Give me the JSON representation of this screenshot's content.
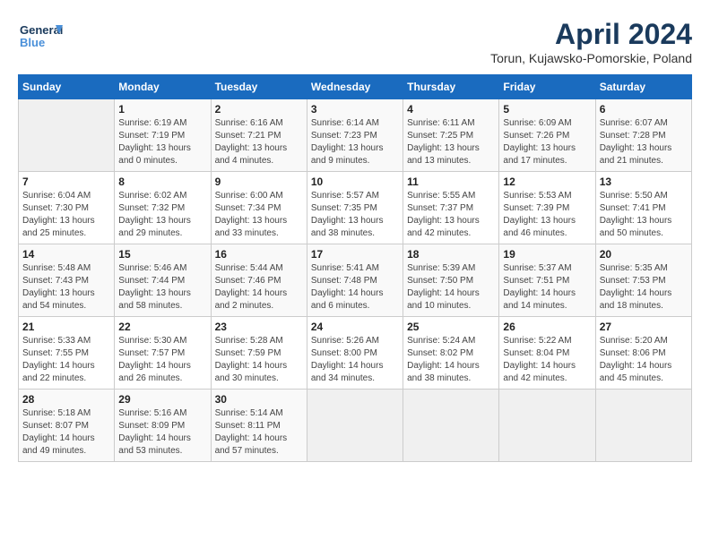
{
  "header": {
    "logo_line1": "General",
    "logo_line2": "Blue",
    "title": "April 2024",
    "location": "Torun, Kujawsko-Pomorskie, Poland"
  },
  "days_of_week": [
    "Sunday",
    "Monday",
    "Tuesday",
    "Wednesday",
    "Thursday",
    "Friday",
    "Saturday"
  ],
  "weeks": [
    [
      {
        "day": "",
        "info": ""
      },
      {
        "day": "1",
        "info": "Sunrise: 6:19 AM\nSunset: 7:19 PM\nDaylight: 13 hours\nand 0 minutes."
      },
      {
        "day": "2",
        "info": "Sunrise: 6:16 AM\nSunset: 7:21 PM\nDaylight: 13 hours\nand 4 minutes."
      },
      {
        "day": "3",
        "info": "Sunrise: 6:14 AM\nSunset: 7:23 PM\nDaylight: 13 hours\nand 9 minutes."
      },
      {
        "day": "4",
        "info": "Sunrise: 6:11 AM\nSunset: 7:25 PM\nDaylight: 13 hours\nand 13 minutes."
      },
      {
        "day": "5",
        "info": "Sunrise: 6:09 AM\nSunset: 7:26 PM\nDaylight: 13 hours\nand 17 minutes."
      },
      {
        "day": "6",
        "info": "Sunrise: 6:07 AM\nSunset: 7:28 PM\nDaylight: 13 hours\nand 21 minutes."
      }
    ],
    [
      {
        "day": "7",
        "info": "Sunrise: 6:04 AM\nSunset: 7:30 PM\nDaylight: 13 hours\nand 25 minutes."
      },
      {
        "day": "8",
        "info": "Sunrise: 6:02 AM\nSunset: 7:32 PM\nDaylight: 13 hours\nand 29 minutes."
      },
      {
        "day": "9",
        "info": "Sunrise: 6:00 AM\nSunset: 7:34 PM\nDaylight: 13 hours\nand 33 minutes."
      },
      {
        "day": "10",
        "info": "Sunrise: 5:57 AM\nSunset: 7:35 PM\nDaylight: 13 hours\nand 38 minutes."
      },
      {
        "day": "11",
        "info": "Sunrise: 5:55 AM\nSunset: 7:37 PM\nDaylight: 13 hours\nand 42 minutes."
      },
      {
        "day": "12",
        "info": "Sunrise: 5:53 AM\nSunset: 7:39 PM\nDaylight: 13 hours\nand 46 minutes."
      },
      {
        "day": "13",
        "info": "Sunrise: 5:50 AM\nSunset: 7:41 PM\nDaylight: 13 hours\nand 50 minutes."
      }
    ],
    [
      {
        "day": "14",
        "info": "Sunrise: 5:48 AM\nSunset: 7:43 PM\nDaylight: 13 hours\nand 54 minutes."
      },
      {
        "day": "15",
        "info": "Sunrise: 5:46 AM\nSunset: 7:44 PM\nDaylight: 13 hours\nand 58 minutes."
      },
      {
        "day": "16",
        "info": "Sunrise: 5:44 AM\nSunset: 7:46 PM\nDaylight: 14 hours\nand 2 minutes."
      },
      {
        "day": "17",
        "info": "Sunrise: 5:41 AM\nSunset: 7:48 PM\nDaylight: 14 hours\nand 6 minutes."
      },
      {
        "day": "18",
        "info": "Sunrise: 5:39 AM\nSunset: 7:50 PM\nDaylight: 14 hours\nand 10 minutes."
      },
      {
        "day": "19",
        "info": "Sunrise: 5:37 AM\nSunset: 7:51 PM\nDaylight: 14 hours\nand 14 minutes."
      },
      {
        "day": "20",
        "info": "Sunrise: 5:35 AM\nSunset: 7:53 PM\nDaylight: 14 hours\nand 18 minutes."
      }
    ],
    [
      {
        "day": "21",
        "info": "Sunrise: 5:33 AM\nSunset: 7:55 PM\nDaylight: 14 hours\nand 22 minutes."
      },
      {
        "day": "22",
        "info": "Sunrise: 5:30 AM\nSunset: 7:57 PM\nDaylight: 14 hours\nand 26 minutes."
      },
      {
        "day": "23",
        "info": "Sunrise: 5:28 AM\nSunset: 7:59 PM\nDaylight: 14 hours\nand 30 minutes."
      },
      {
        "day": "24",
        "info": "Sunrise: 5:26 AM\nSunset: 8:00 PM\nDaylight: 14 hours\nand 34 minutes."
      },
      {
        "day": "25",
        "info": "Sunrise: 5:24 AM\nSunset: 8:02 PM\nDaylight: 14 hours\nand 38 minutes."
      },
      {
        "day": "26",
        "info": "Sunrise: 5:22 AM\nSunset: 8:04 PM\nDaylight: 14 hours\nand 42 minutes."
      },
      {
        "day": "27",
        "info": "Sunrise: 5:20 AM\nSunset: 8:06 PM\nDaylight: 14 hours\nand 45 minutes."
      }
    ],
    [
      {
        "day": "28",
        "info": "Sunrise: 5:18 AM\nSunset: 8:07 PM\nDaylight: 14 hours\nand 49 minutes."
      },
      {
        "day": "29",
        "info": "Sunrise: 5:16 AM\nSunset: 8:09 PM\nDaylight: 14 hours\nand 53 minutes."
      },
      {
        "day": "30",
        "info": "Sunrise: 5:14 AM\nSunset: 8:11 PM\nDaylight: 14 hours\nand 57 minutes."
      },
      {
        "day": "",
        "info": ""
      },
      {
        "day": "",
        "info": ""
      },
      {
        "day": "",
        "info": ""
      },
      {
        "day": "",
        "info": ""
      }
    ]
  ]
}
